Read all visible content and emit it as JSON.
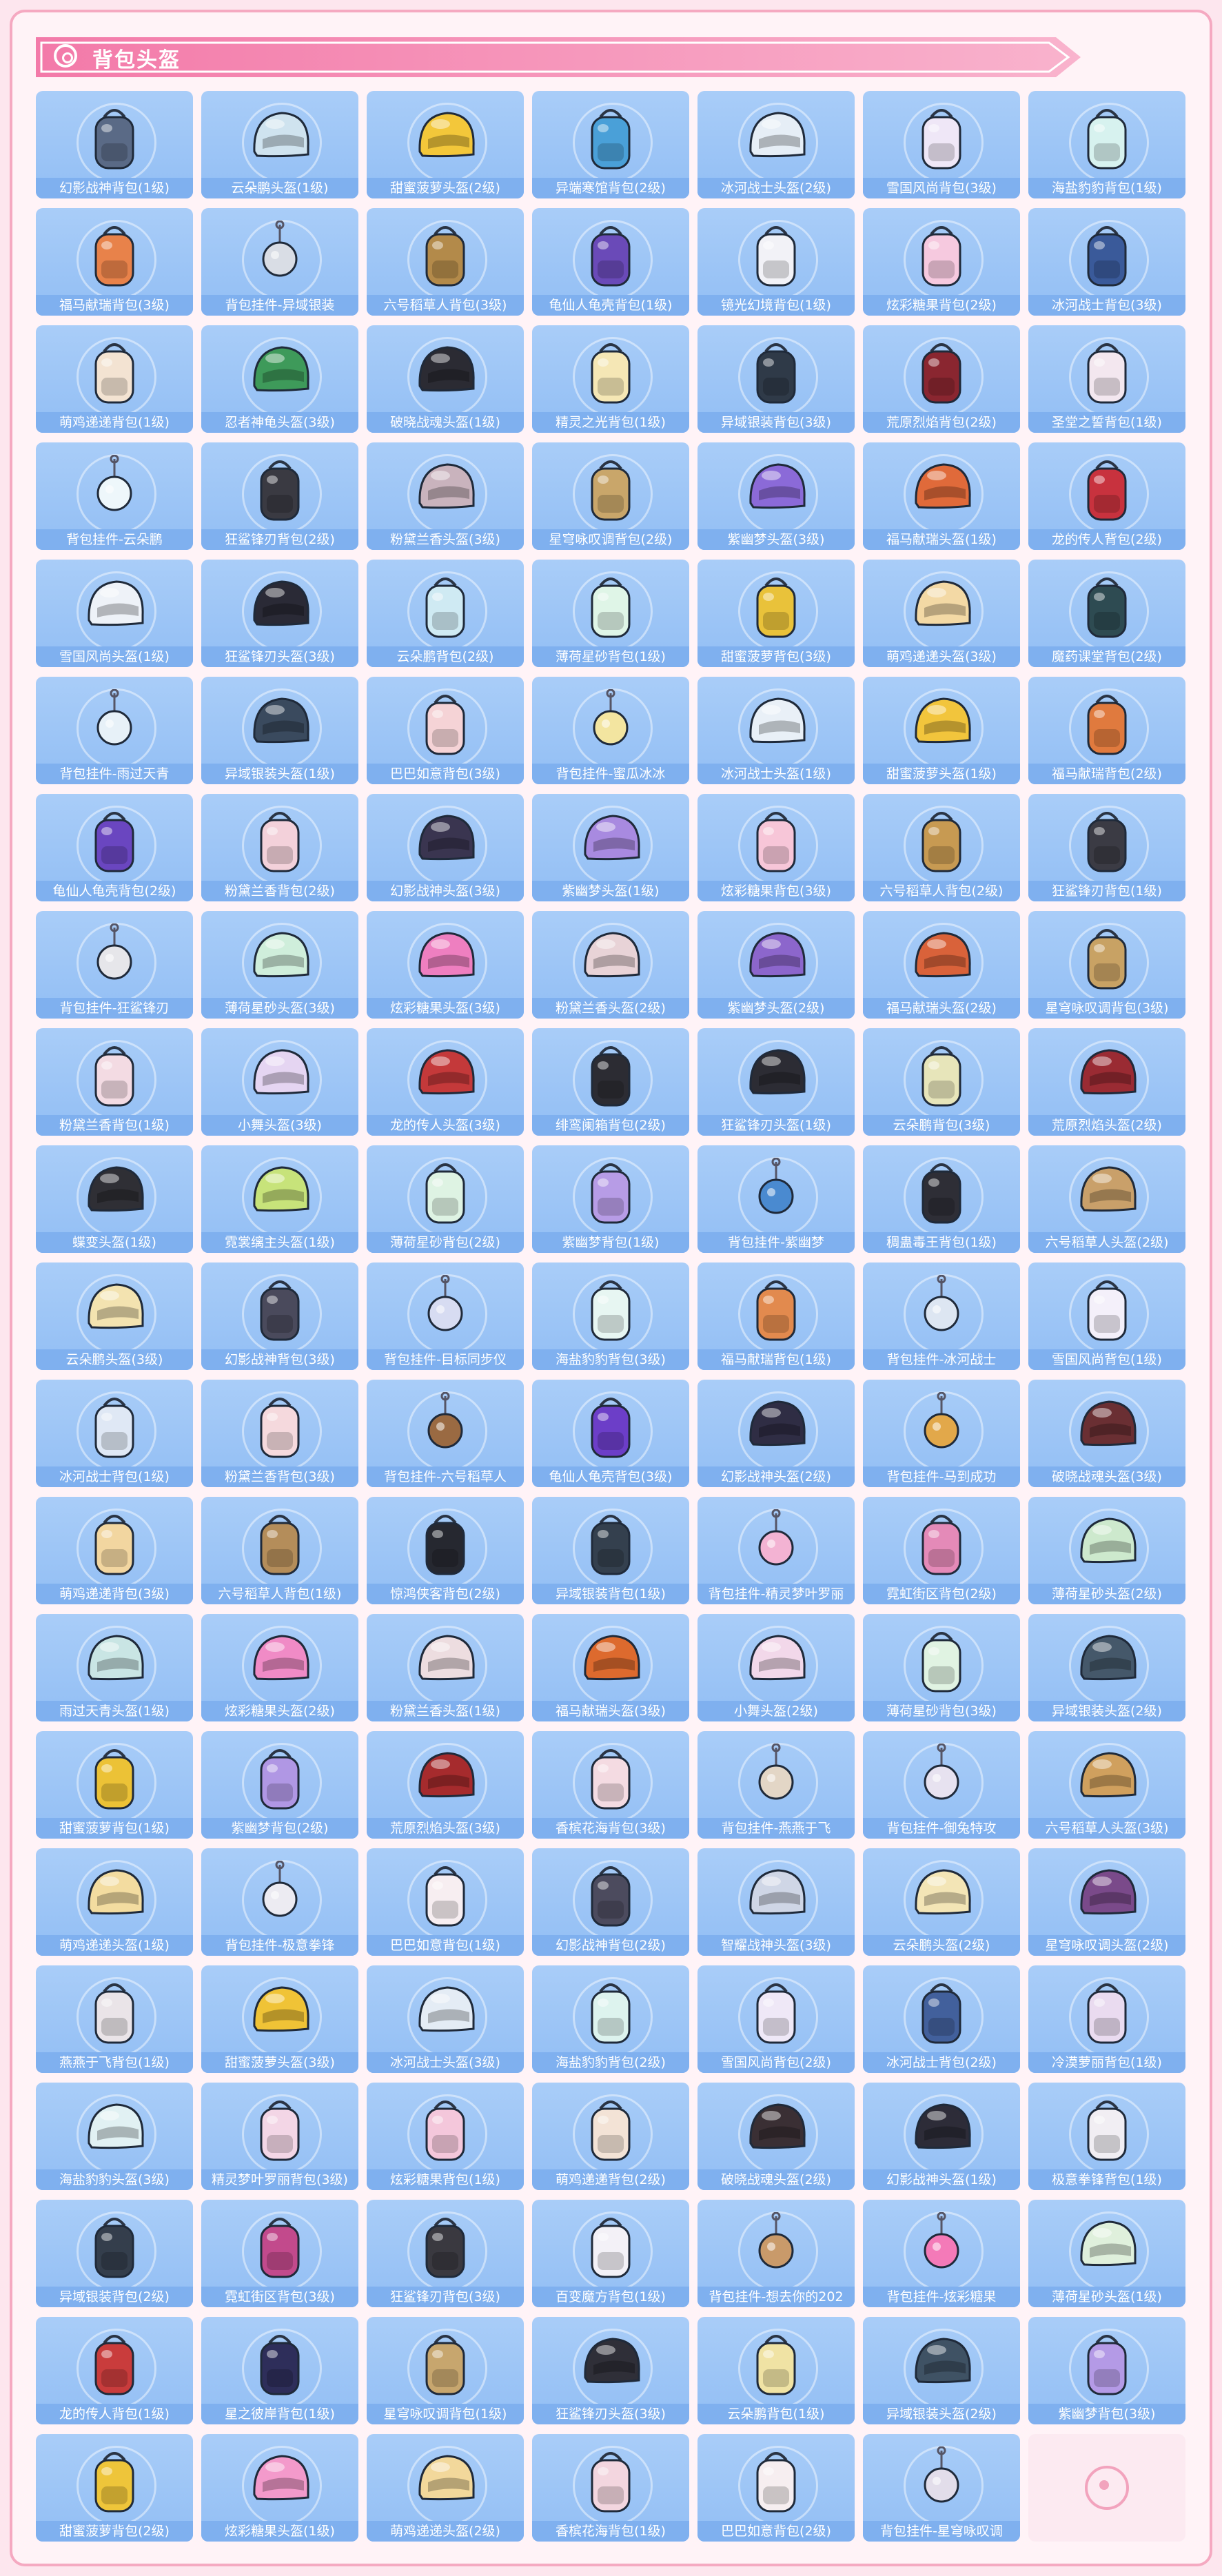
{
  "section": {
    "title": "背包头盔",
    "accent": "#f48fb4",
    "tile_color": "#a9cdf8"
  },
  "items": [
    {
      "label": "幻影战神背包(1级)",
      "kind": "backpack",
      "color": "#5a6a86"
    },
    {
      "label": "云朵鹏头盔(1级)",
      "kind": "helmet",
      "color": "#cfe3ef"
    },
    {
      "label": "甜蜜菠萝头盔(2级)",
      "kind": "helmet",
      "color": "#f3c73a"
    },
    {
      "label": "异端寒馆背包(2级)",
      "kind": "backpack",
      "color": "#4aa0d8"
    },
    {
      "label": "冰河战士头盔(2级)",
      "kind": "helmet",
      "color": "#e6eef6"
    },
    {
      "label": "雪国风尚背包(3级)",
      "kind": "backpack",
      "color": "#efe7f7"
    },
    {
      "label": "海盐豹豹背包(1级)",
      "kind": "backpack",
      "color": "#d7f2ef"
    },
    {
      "label": "福马献瑞背包(3级)",
      "kind": "backpack",
      "color": "#e8824a"
    },
    {
      "label": "背包挂件-异域银装",
      "kind": "charm",
      "color": "#d9dde5"
    },
    {
      "label": "六号稻草人背包(3级)",
      "kind": "backpack",
      "color": "#b38a4a"
    },
    {
      "label": "龟仙人龟壳背包(1级)",
      "kind": "backpack",
      "color": "#6a4ab8"
    },
    {
      "label": "镜光幻境背包(1级)",
      "kind": "backpack",
      "color": "#f2f2f7"
    },
    {
      "label": "炫彩糖果背包(2级)",
      "kind": "backpack",
      "color": "#f6c9df"
    },
    {
      "label": "冰河战士背包(3级)",
      "kind": "backpack",
      "color": "#3a5a9a"
    },
    {
      "label": "萌鸡递递背包(1级)",
      "kind": "backpack",
      "color": "#f3e3d2"
    },
    {
      "label": "忍者神龟头盔(3级)",
      "kind": "helmet",
      "color": "#3e9a5a"
    },
    {
      "label": "破晓战魂头盔(1级)",
      "kind": "helmet",
      "color": "#2b2b33"
    },
    {
      "label": "精灵之光背包(1级)",
      "kind": "backpack",
      "color": "#f5e7b5"
    },
    {
      "label": "异域银装背包(3级)",
      "kind": "backpack",
      "color": "#2f3a48"
    },
    {
      "label": "荒原烈焰背包(2级)",
      "kind": "backpack",
      "color": "#8a2630"
    },
    {
      "label": "圣堂之誓背包(1级)",
      "kind": "backpack",
      "color": "#f3e7ef"
    },
    {
      "label": "背包挂件-云朵鹏",
      "kind": "charm",
      "color": "#eef7fb"
    },
    {
      "label": "狂鲨锋刃背包(2级)",
      "kind": "backpack",
      "color": "#3a3a42"
    },
    {
      "label": "粉黛兰香头盔(3级)",
      "kind": "helmet",
      "color": "#c9b3bd"
    },
    {
      "label": "星穹咏叹调背包(2级)",
      "kind": "backpack",
      "color": "#c9a66a"
    },
    {
      "label": "紫幽梦头盔(3级)",
      "kind": "helmet",
      "color": "#8b6ad8"
    },
    {
      "label": "福马献瑞头盔(1级)",
      "kind": "helmet",
      "color": "#e06a3a"
    },
    {
      "label": "龙的传人背包(2级)",
      "kind": "backpack",
      "color": "#c8323e"
    },
    {
      "label": "雪国风尚头盔(1级)",
      "kind": "helmet",
      "color": "#eef2f8"
    },
    {
      "label": "狂鲨锋刃头盔(3级)",
      "kind": "helmet",
      "color": "#2a2a36"
    },
    {
      "label": "云朵鹏背包(2级)",
      "kind": "backpack",
      "color": "#cfeaf3"
    },
    {
      "label": "薄荷星砂背包(1级)",
      "kind": "backpack",
      "color": "#dff5e7"
    },
    {
      "label": "甜蜜菠萝背包(3级)",
      "kind": "backpack",
      "color": "#e9c23a"
    },
    {
      "label": "萌鸡递递头盔(3级)",
      "kind": "helmet",
      "color": "#f3d9a5"
    },
    {
      "label": "魔药课堂背包(2级)",
      "kind": "backpack",
      "color": "#2e4b52"
    },
    {
      "label": "背包挂件-雨过天青",
      "kind": "charm",
      "color": "#e7f1f8"
    },
    {
      "label": "异域银装头盔(1级)",
      "kind": "helmet",
      "color": "#3a4a5e"
    },
    {
      "label": "巴巴如意背包(3级)",
      "kind": "backpack",
      "color": "#f5d3d6"
    },
    {
      "label": "背包挂件-蜜瓜冰冰",
      "kind": "charm",
      "color": "#f3e5a0"
    },
    {
      "label": "冰河战士头盔(1级)",
      "kind": "helmet",
      "color": "#e9f0f7"
    },
    {
      "label": "甜蜜菠萝头盔(1级)",
      "kind": "helmet",
      "color": "#f2c53c"
    },
    {
      "label": "福马献瑞背包(2级)",
      "kind": "backpack",
      "color": "#e07a3e"
    },
    {
      "label": "龟仙人龟壳背包(2级)",
      "kind": "backpack",
      "color": "#6a46c0"
    },
    {
      "label": "粉黛兰香背包(2级)",
      "kind": "backpack",
      "color": "#f3d1da"
    },
    {
      "label": "幻影战神头盔(3级)",
      "kind": "helmet",
      "color": "#3a3550"
    },
    {
      "label": "紫幽梦头盔(1级)",
      "kind": "helmet",
      "color": "#a88ae0"
    },
    {
      "label": "炫彩糖果背包(3级)",
      "kind": "backpack",
      "color": "#f7c6d8"
    },
    {
      "label": "六号稻草人背包(2级)",
      "kind": "backpack",
      "color": "#c79a52"
    },
    {
      "label": "狂鲨锋刃背包(1级)",
      "kind": "backpack",
      "color": "#3b3b44"
    },
    {
      "label": "背包挂件-狂鲨锋刃",
      "kind": "charm",
      "color": "#e6e6ea"
    },
    {
      "label": "薄荷星砂头盔(3级)",
      "kind": "helmet",
      "color": "#cfeedb"
    },
    {
      "label": "炫彩糖果头盔(3级)",
      "kind": "helmet",
      "color": "#ee7fc0"
    },
    {
      "label": "粉黛兰香头盔(2级)",
      "kind": "helmet",
      "color": "#e8d3d7"
    },
    {
      "label": "紫幽梦头盔(2级)",
      "kind": "helmet",
      "color": "#8c66cc"
    },
    {
      "label": "福马献瑞头盔(2级)",
      "kind": "helmet",
      "color": "#d9623a"
    },
    {
      "label": "星穹咏叹调背包(3级)",
      "kind": "backpack",
      "color": "#c8a264"
    },
    {
      "label": "粉黛兰香背包(1级)",
      "kind": "backpack",
      "color": "#f3dbe3"
    },
    {
      "label": "小舞头盔(3级)",
      "kind": "helmet",
      "color": "#e5d5f2"
    },
    {
      "label": "龙的传人头盔(3级)",
      "kind": "helmet",
      "color": "#c4393a"
    },
    {
      "label": "绯鸾阑箱背包(2级)",
      "kind": "backpack",
      "color": "#2c2c33"
    },
    {
      "label": "狂鲨锋刃头盔(1级)",
      "kind": "helmet",
      "color": "#2c2c34"
    },
    {
      "label": "云朵鹏背包(3级)",
      "kind": "backpack",
      "color": "#e7e5ba"
    },
    {
      "label": "荒原烈焰头盔(2级)",
      "kind": "helmet",
      "color": "#9a2b33"
    },
    {
      "label": "蝶变头盔(1级)",
      "kind": "helmet",
      "color": "#2f2f35"
    },
    {
      "label": "霓裳缡主头盔(1级)",
      "kind": "helmet",
      "color": "#c7e37a"
    },
    {
      "label": "薄荷星砂背包(2级)",
      "kind": "backpack",
      "color": "#def3e3"
    },
    {
      "label": "紫幽梦背包(1级)",
      "kind": "backpack",
      "color": "#b79ce6"
    },
    {
      "label": "背包挂件-紫幽梦",
      "kind": "charm",
      "color": "#4a8ad0"
    },
    {
      "label": "稠蛊毒王背包(1级)",
      "kind": "backpack",
      "color": "#2e2e36"
    },
    {
      "label": "六号稻草人头盔(2级)",
      "kind": "helmet",
      "color": "#c9a06a"
    },
    {
      "label": "云朵鹏头盔(3级)",
      "kind": "helmet",
      "color": "#f3e3b0"
    },
    {
      "label": "幻影战神背包(3级)",
      "kind": "backpack",
      "color": "#4a4a5c"
    },
    {
      "label": "背包挂件-目标同步仪",
      "kind": "charm",
      "color": "#d7dcf2"
    },
    {
      "label": "海盐豹豹背包(3级)",
      "kind": "backpack",
      "color": "#e7f6f2"
    },
    {
      "label": "福马献瑞背包(1级)",
      "kind": "backpack",
      "color": "#e28a4e"
    },
    {
      "label": "背包挂件-冰河战士",
      "kind": "charm",
      "color": "#dde6f2"
    },
    {
      "label": "雪国风尚背包(1级)",
      "kind": "backpack",
      "color": "#f4f0fa"
    },
    {
      "label": "冰河战士背包(1级)",
      "kind": "backpack",
      "color": "#dfe8f5"
    },
    {
      "label": "粉黛兰香背包(3级)",
      "kind": "backpack",
      "color": "#f5d9dd"
    },
    {
      "label": "背包挂件-六号稻草人",
      "kind": "charm",
      "color": "#9a6a42"
    },
    {
      "label": "龟仙人龟壳背包(3级)",
      "kind": "backpack",
      "color": "#6c3ec8"
    },
    {
      "label": "幻影战神头盔(2级)",
      "kind": "helmet",
      "color": "#2f2d44"
    },
    {
      "label": "背包挂件-马到成功",
      "kind": "charm",
      "color": "#e2a84a"
    },
    {
      "label": "破晓战魂头盔(3级)",
      "kind": "helmet",
      "color": "#6a2f33"
    },
    {
      "label": "萌鸡递递背包(3级)",
      "kind": "backpack",
      "color": "#f2d6a0"
    },
    {
      "label": "六号稻草人背包(1级)",
      "kind": "backpack",
      "color": "#b48d5a"
    },
    {
      "label": "惊鸿侠客背包(2级)",
      "kind": "backpack",
      "color": "#262830"
    },
    {
      "label": "异域银装背包(1级)",
      "kind": "backpack",
      "color": "#34404e"
    },
    {
      "label": "背包挂件-精灵梦叶罗丽",
      "kind": "charm",
      "color": "#f3b3d3"
    },
    {
      "label": "霓虹街区背包(2级)",
      "kind": "backpack",
      "color": "#e48ab8"
    },
    {
      "label": "薄荷星砂头盔(2级)",
      "kind": "helmet",
      "color": "#cde9cd"
    },
    {
      "label": "雨过天青头盔(1级)",
      "kind": "helmet",
      "color": "#c9e5e4"
    },
    {
      "label": "炫彩糖果头盔(2级)",
      "kind": "helmet",
      "color": "#f08bc6"
    },
    {
      "label": "粉黛兰香头盔(1级)",
      "kind": "helmet",
      "color": "#eddde0"
    },
    {
      "label": "福马献瑞头盔(3级)",
      "kind": "helmet",
      "color": "#dd6a2e"
    },
    {
      "label": "小舞头盔(2级)",
      "kind": "helmet",
      "color": "#f2d8ea"
    },
    {
      "label": "薄荷星砂背包(3级)",
      "kind": "backpack",
      "color": "#e0f3e2"
    },
    {
      "label": "异域银装头盔(2级)",
      "kind": "helmet",
      "color": "#45586a"
    },
    {
      "label": "甜蜜菠萝背包(1级)",
      "kind": "backpack",
      "color": "#ecc236"
    },
    {
      "label": "紫幽梦背包(2级)",
      "kind": "backpack",
      "color": "#b097e4"
    },
    {
      "label": "荒原烈焰头盔(3级)",
      "kind": "helmet",
      "color": "#a62b2d"
    },
    {
      "label": "香槟花海背包(3级)",
      "kind": "backpack",
      "color": "#f4dbe2"
    },
    {
      "label": "背包挂件-燕燕于飞",
      "kind": "charm",
      "color": "#e3d6c6"
    },
    {
      "label": "背包挂件-御兔特攻",
      "kind": "charm",
      "color": "#e7e2f0"
    },
    {
      "label": "六号稻草人头盔(3级)",
      "kind": "helmet",
      "color": "#d0a05e"
    },
    {
      "label": "萌鸡递递头盔(1级)",
      "kind": "helmet",
      "color": "#f3dca0"
    },
    {
      "label": "背包挂件-极意拳锋",
      "kind": "charm",
      "color": "#ecebf2"
    },
    {
      "label": "巴巴如意背包(1级)",
      "kind": "backpack",
      "color": "#f7eef1"
    },
    {
      "label": "幻影战神背包(2级)",
      "kind": "backpack",
      "color": "#4c4b5e"
    },
    {
      "label": "智耀战神头盔(3级)",
      "kind": "helmet",
      "color": "#cfd6e6"
    },
    {
      "label": "云朵鹏头盔(2级)",
      "kind": "helmet",
      "color": "#f3e5b6"
    },
    {
      "label": "星穹咏叹调头盔(2级)",
      "kind": "helmet",
      "color": "#7a4a8a"
    },
    {
      "label": "燕燕于飞背包(1级)",
      "kind": "backpack",
      "color": "#eae4e8"
    },
    {
      "label": "甜蜜菠萝头盔(3级)",
      "kind": "helmet",
      "color": "#f0c336"
    },
    {
      "label": "冰河战士头盔(3级)",
      "kind": "helmet",
      "color": "#e4ecf5"
    },
    {
      "label": "海盐豹豹背包(2级)",
      "kind": "backpack",
      "color": "#ddf3ee"
    },
    {
      "label": "雪国风尚背包(2级)",
      "kind": "backpack",
      "color": "#efe8f7"
    },
    {
      "label": "冰河战士背包(2级)",
      "kind": "backpack",
      "color": "#42609c"
    },
    {
      "label": "冷漠萝丽背包(1级)",
      "kind": "backpack",
      "color": "#eadbf0"
    },
    {
      "label": "海盐豹豹头盔(3级)",
      "kind": "helmet",
      "color": "#e1f1f3"
    },
    {
      "label": "精灵梦叶罗丽背包(3级)",
      "kind": "backpack",
      "color": "#f3d6e6"
    },
    {
      "label": "炫彩糖果背包(1级)",
      "kind": "backpack",
      "color": "#f4c7db"
    },
    {
      "label": "萌鸡递递背包(2级)",
      "kind": "backpack",
      "color": "#f3e3d6"
    },
    {
      "label": "破晓战魂头盔(2级)",
      "kind": "helmet",
      "color": "#3a2f34"
    },
    {
      "label": "幻影战神头盔(1级)",
      "kind": "helmet",
      "color": "#2d2c38"
    },
    {
      "label": "极意拳锋背包(1级)",
      "kind": "backpack",
      "color": "#f1eef3"
    },
    {
      "label": "异域银装背包(2级)",
      "kind": "backpack",
      "color": "#343e4c"
    },
    {
      "label": "霓虹街区背包(3级)",
      "kind": "backpack",
      "color": "#c24a8c"
    },
    {
      "label": "狂鲨锋刃背包(3级)",
      "kind": "backpack",
      "color": "#3a3940"
    },
    {
      "label": "百变魔方背包(1级)",
      "kind": "backpack",
      "color": "#f3f1f7"
    },
    {
      "label": "背包挂件-想去你的202",
      "kind": "charm",
      "color": "#c99a6a"
    },
    {
      "label": "背包挂件-炫彩糖果",
      "kind": "charm",
      "color": "#f47ab8"
    },
    {
      "label": "薄荷星砂头盔(1级)",
      "kind": "helmet",
      "color": "#dff0dc"
    },
    {
      "label": "龙的传人背包(1级)",
      "kind": "backpack",
      "color": "#c93c3c"
    },
    {
      "label": "星之彼岸背包(1级)",
      "kind": "backpack",
      "color": "#2e2e5a"
    },
    {
      "label": "星穹咏叹调背包(1级)",
      "kind": "backpack",
      "color": "#c7a66e"
    },
    {
      "label": "狂鲨锋刃头盔(3级)",
      "kind": "helmet",
      "color": "#2f2f38"
    },
    {
      "label": "云朵鹏背包(1级)",
      "kind": "backpack",
      "color": "#f0e3a4"
    },
    {
      "label": "异域银装头盔(2级)",
      "kind": "helmet",
      "color": "#3f5264"
    },
    {
      "label": "紫幽梦背包(3级)",
      "kind": "backpack",
      "color": "#b49ae6"
    },
    {
      "label": "甜蜜菠萝背包(2级)",
      "kind": "backpack",
      "color": "#eec53a"
    },
    {
      "label": "炫彩糖果头盔(1级)",
      "kind": "helmet",
      "color": "#f39acb"
    },
    {
      "label": "萌鸡递递头盔(2级)",
      "kind": "helmet",
      "color": "#f2d89b"
    },
    {
      "label": "香槟花海背包(1级)",
      "kind": "backpack",
      "color": "#f3d6df"
    },
    {
      "label": "巴巴如意背包(2级)",
      "kind": "backpack",
      "color": "#f6eef0"
    },
    {
      "label": "背包挂件-星穹咏叹调",
      "kind": "charm",
      "color": "#e2ddea"
    }
  ]
}
